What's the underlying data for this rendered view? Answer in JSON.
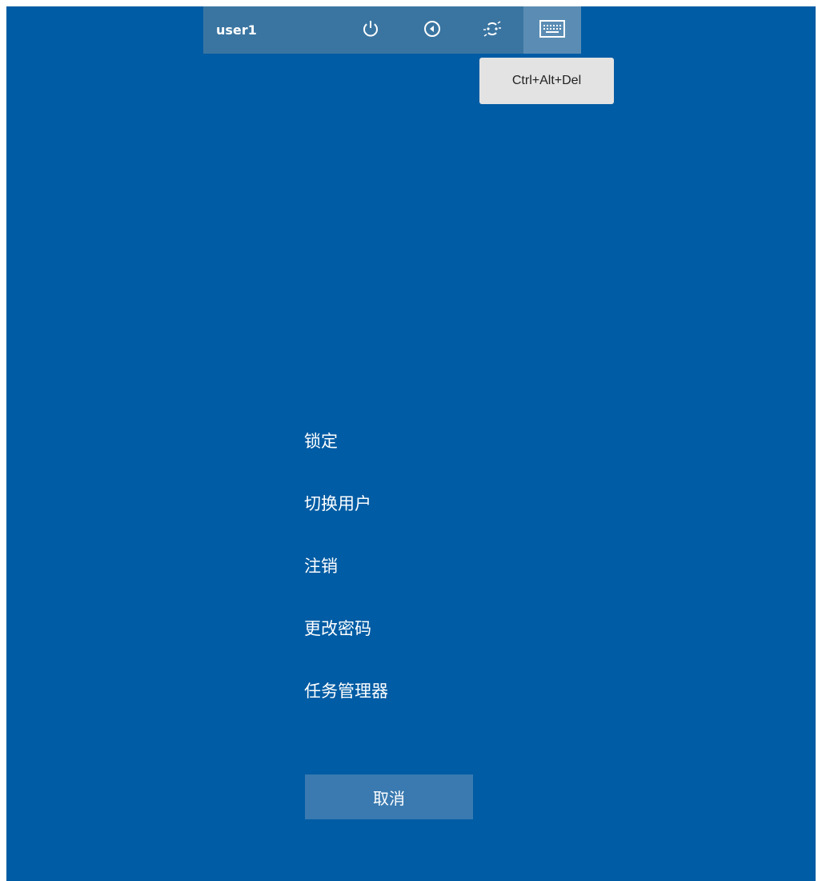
{
  "toolbar": {
    "username": "user1",
    "buttons": [
      {
        "icon": "power-icon",
        "active": false
      },
      {
        "icon": "ease-of-access-icon",
        "active": false
      },
      {
        "icon": "network-icon",
        "active": false
      },
      {
        "icon": "keyboard-icon",
        "active": true
      }
    ],
    "tooltip": "Ctrl+Alt+Del"
  },
  "menu": {
    "items": [
      "锁定",
      "切换用户",
      "注销",
      "更改密码",
      "任务管理器"
    ],
    "cancel": "取消"
  },
  "colors": {
    "background": "#005ca4",
    "toolbar": "#3a75a1",
    "toolbar_active": "#5b8db4",
    "cancel_button": "#3a7ab0",
    "tooltip_bg": "#e3e3e3"
  }
}
